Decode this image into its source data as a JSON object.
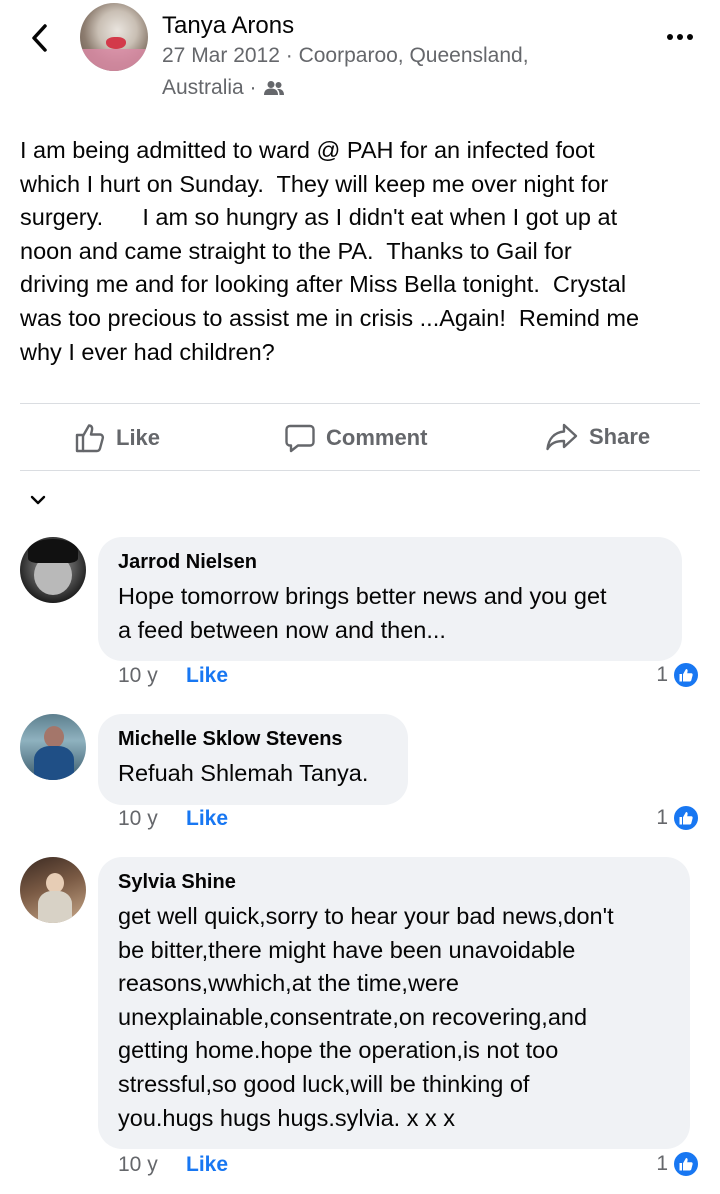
{
  "post": {
    "author": "Tanya Arons",
    "date_location": "27 Mar 2012 · Coorparoo, Queensland,",
    "location_cont": "Australia ·",
    "audience_icon": "friends-icon",
    "text": "I am being admitted to ward @ PAH for an infected foot\nwhich I hurt on Sunday.  They will keep me over night for\nsurgery.      I am so hungry as I didn't eat when I got up at\nnoon and came straight to the PA.  Thanks to Gail for\ndriving me and for looking after Miss Bella tonight.  Crystal\nwas too precious to assist me in crisis ...Again!  Remind me\nwhy I ever had children?"
  },
  "actions": {
    "like": "Like",
    "comment": "Comment",
    "share": "Share"
  },
  "comments": [
    {
      "name": "Jarrod Nielsen",
      "text": "Hope tomorrow brings better news and you get\na feed between now and then...",
      "time": "10 y",
      "like_label": "Like",
      "reaction_count": "1"
    },
    {
      "name": "Michelle Sklow Stevens",
      "text": "Refuah Shlemah Tanya.",
      "time": "10 y",
      "like_label": "Like",
      "reaction_count": "1"
    },
    {
      "name": "Sylvia Shine",
      "text": "get well quick,sorry to hear your bad news,don't\nbe bitter,there might have been unavoidable\nreasons,wwhich,at the time,were\nunexplainable,consentrate,on recovering,and\ngetting home.hope the operation,is not too\nstressful,so good luck,will be thinking of\nyou.hugs hugs hugs.sylvia. x x x",
      "time": "10 y",
      "like_label": "Like",
      "reaction_count": "1"
    }
  ],
  "colors": {
    "accent": "#1877f2",
    "secondary_text": "#65676b",
    "bubble": "#f0f2f5"
  }
}
